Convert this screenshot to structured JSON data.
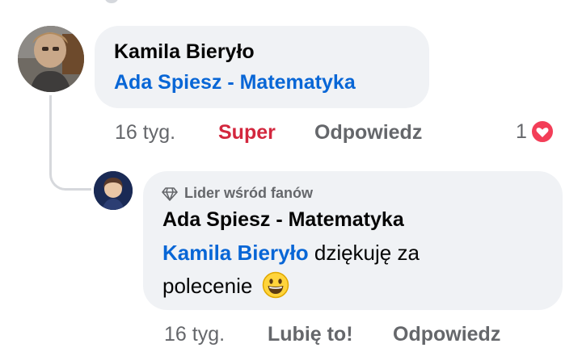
{
  "comment": {
    "author": "Kamila Bieryło",
    "text_link": "Ada Spiesz - Matematyka",
    "time": "16 tyg.",
    "reaction_label": "Super",
    "reply_label": "Odpowiedz",
    "reaction_count": "1",
    "reaction_icon": "heart-icon",
    "reaction_color": "#f33e58"
  },
  "reply": {
    "badge": "Lider wśród fanów",
    "badge_icon": "diamond-icon",
    "author": "Ada Spiesz - Matematyka",
    "mention": "Kamila Bieryło",
    "text_part1": " dziękuję za",
    "text_part2": "polecenie",
    "emoji": "😃",
    "time": "16 tyg.",
    "like_label": "Lubię to!",
    "reply_label": "Odpowiedz"
  },
  "colors": {
    "link": "#0866d6",
    "super": "#d3273e",
    "muted": "#65676b",
    "bubble": "#f0f2f5"
  }
}
